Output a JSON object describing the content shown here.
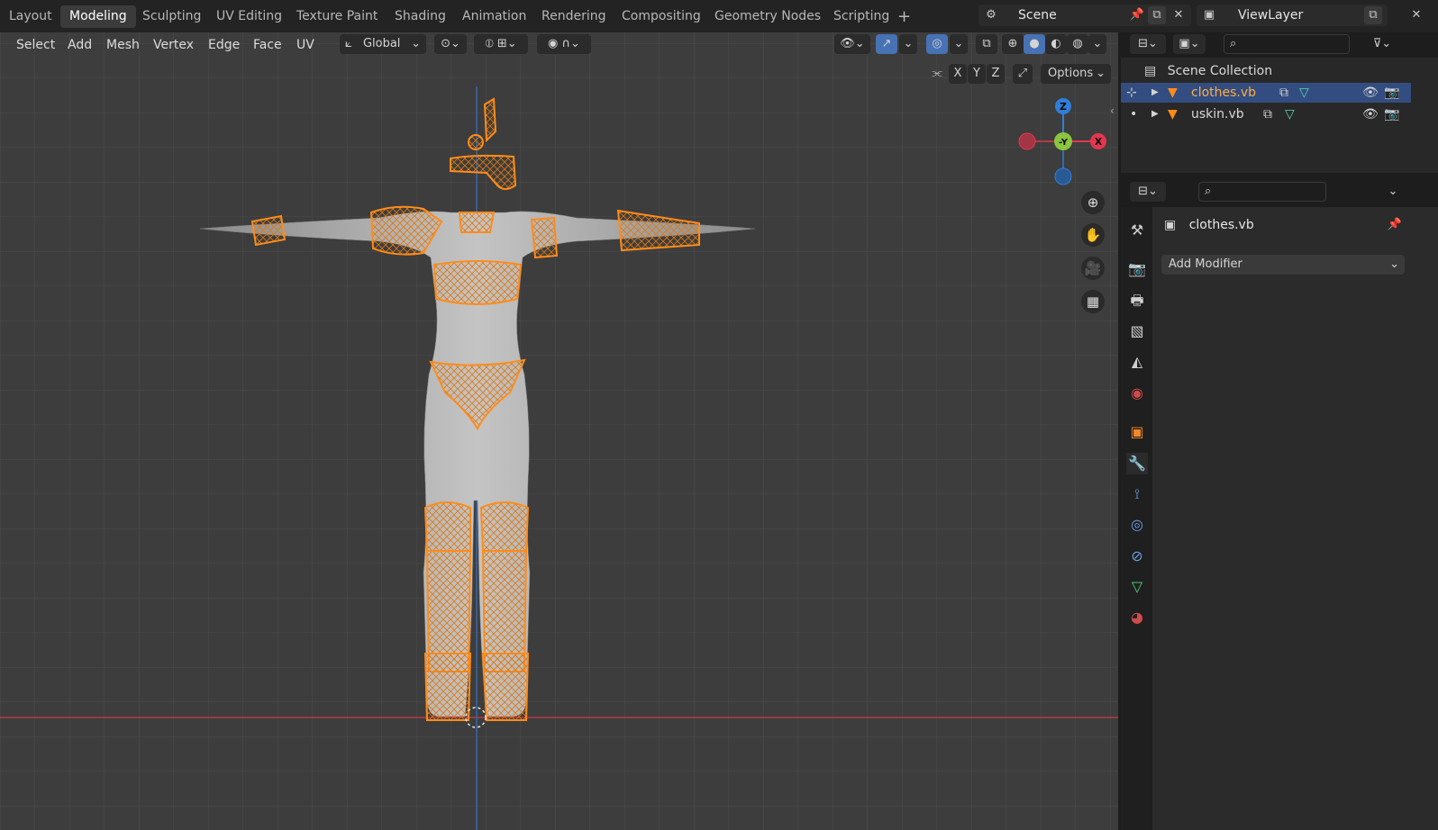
{
  "workspace_tabs": [
    "Layout",
    "Modeling",
    "Sculpting",
    "UV Editing",
    "Texture Paint",
    "Shading",
    "Animation",
    "Rendering",
    "Compositing",
    "Geometry Nodes",
    "Scripting"
  ],
  "active_tab": "Modeling",
  "scene": {
    "name": "Scene"
  },
  "view_layer": {
    "name": "ViewLayer"
  },
  "header_menu": [
    "Select",
    "Add",
    "Mesh",
    "Vertex",
    "Edge",
    "Face",
    "UV"
  ],
  "transform_orientation": "Global",
  "axis_toggles": [
    "X",
    "Y",
    "Z"
  ],
  "options_label": "Options",
  "nav_gizmo": {
    "z": "Z",
    "y": "-Y",
    "x": "X"
  },
  "outliner": {
    "root": "Scene Collection",
    "items": [
      {
        "name": "clothes.vb",
        "selected": true
      },
      {
        "name": "uskin.vb",
        "selected": false
      }
    ]
  },
  "properties": {
    "object_name": "clothes.vb",
    "add_modifier": "Add Modifier"
  },
  "colors": {
    "accent": "#4772b3",
    "selected_orange": "#ff8c1a",
    "x_axis": "#e3374f",
    "y_axis": "#8bc53f",
    "z_axis": "#2f7fd8"
  }
}
